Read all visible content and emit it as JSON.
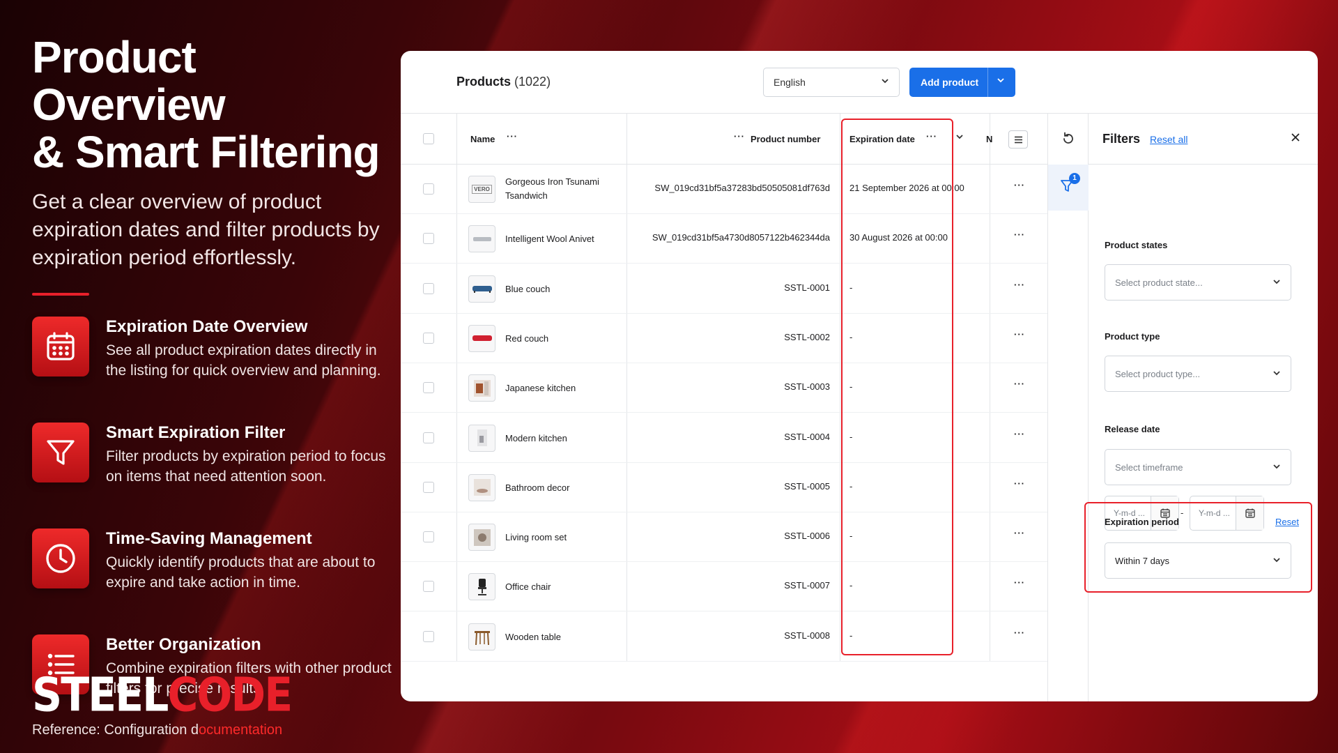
{
  "hero": {
    "title_line1": "Product Overview",
    "title_line2": "& Smart Filtering",
    "subtitle": "Get a clear overview of product expiration dates and filter products by expiration period effortlessly."
  },
  "features": [
    {
      "icon": "calendar-icon",
      "title": "Expiration Date Overview",
      "desc": "See all product expiration dates directly in the listing for quick overview and planning."
    },
    {
      "icon": "filter-icon",
      "title": "Smart Expiration Filter",
      "desc": "Filter products by expiration period to focus on items that need attention soon."
    },
    {
      "icon": "clock-icon",
      "title": "Time-Saving Management",
      "desc": "Quickly identify products that are about to expire and take action in time."
    },
    {
      "icon": "list-icon",
      "title": "Better Organization",
      "desc": "Combine expiration filters with other product filters for precise results."
    }
  ],
  "brand": {
    "part1": "STEEL",
    "part2": "CODE"
  },
  "reference": {
    "prefix": "Reference: Configuration d",
    "link": "ocumentation"
  },
  "app": {
    "products_label": "Products",
    "products_count": "(1022)",
    "language": "English",
    "add_product": "Add product",
    "columns": {
      "name": "Name",
      "product_number": "Product number",
      "expiration_date": "Expiration date",
      "truncated": "N"
    },
    "rows": [
      {
        "name": "Gorgeous Iron Tsunami Tsandwich",
        "number": "SW_019cd31bf5a37283bd50505081df763d",
        "expiration": "21 September 2026 at 00:00",
        "thumb": "vero-logo-thumb",
        "thumb_text": "VERO"
      },
      {
        "name": "Intelligent Wool Anivet",
        "number": "SW_019cd31bf5a4730d8057122b462344da",
        "expiration": "30 August 2026 at 00:00",
        "thumb": "gray-product-thumb"
      },
      {
        "name": "Blue couch",
        "number": "SSTL-0001",
        "expiration": "-",
        "thumb": "blue-couch-thumb"
      },
      {
        "name": "Red couch",
        "number": "SSTL-0002",
        "expiration": "-",
        "thumb": "red-couch-thumb"
      },
      {
        "name": "Japanese kitchen",
        "number": "SSTL-0003",
        "expiration": "-",
        "thumb": "kitchen-thumb"
      },
      {
        "name": "Modern kitchen",
        "number": "SSTL-0004",
        "expiration": "-",
        "thumb": "modern-kitchen-thumb"
      },
      {
        "name": "Bathroom decor",
        "number": "SSTL-0005",
        "expiration": "-",
        "thumb": "bathroom-thumb"
      },
      {
        "name": "Living room set",
        "number": "SSTL-0006",
        "expiration": "-",
        "thumb": "living-room-thumb"
      },
      {
        "name": "Office chair",
        "number": "SSTL-0007",
        "expiration": "-",
        "thumb": "office-chair-thumb"
      },
      {
        "name": "Wooden table",
        "number": "SSTL-0008",
        "expiration": "-",
        "thumb": "wooden-table-thumb"
      }
    ],
    "filter_badge": "1",
    "filters": {
      "title": "Filters",
      "reset_all": "Reset all",
      "product_states_label": "Product states",
      "product_states_placeholder": "Select product state...",
      "product_type_label": "Product type",
      "product_type_placeholder": "Select product type...",
      "release_date_label": "Release date",
      "release_date_placeholder": "Select timeframe",
      "date_from_placeholder": "Y-m-d ...",
      "date_to_placeholder": "Y-m-d ...",
      "date_separator": "-",
      "expiration_period_label": "Expiration period",
      "expiration_reset": "Reset",
      "expiration_period_value": "Within 7 days"
    }
  },
  "colors": {
    "accent_red": "#e8202a",
    "primary_blue": "#1a6fe8"
  }
}
